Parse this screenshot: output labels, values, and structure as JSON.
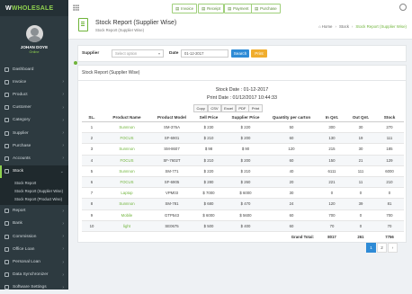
{
  "app": {
    "logo_prefix": "W",
    "logo_text": "WHOLESALE"
  },
  "user": {
    "name": "JOHAN DOYE",
    "status": "Online"
  },
  "sidebar": {
    "items": [
      {
        "label": "Dashboard",
        "icon": "dashboard-icon",
        "has_children": false
      },
      {
        "label": "Invoice",
        "icon": "invoice-icon",
        "has_children": true
      },
      {
        "label": "Product",
        "icon": "product-icon",
        "has_children": true
      },
      {
        "label": "Customer",
        "icon": "customer-icon",
        "has_children": true
      },
      {
        "label": "Category",
        "icon": "category-icon",
        "has_children": true
      },
      {
        "label": "Supplier",
        "icon": "supplier-icon",
        "has_children": true
      },
      {
        "label": "Purchase",
        "icon": "purchase-icon",
        "has_children": true
      },
      {
        "label": "Accounts",
        "icon": "accounts-icon",
        "has_children": true
      },
      {
        "label": "Stock",
        "icon": "stock-icon",
        "has_children": true,
        "active": true
      }
    ],
    "stock_sub": [
      "Stock Report",
      "Stock Report (Supplier Wise)",
      "Stock Report (Product Wise)"
    ],
    "items_after": [
      {
        "label": "Report",
        "icon": "report-icon",
        "has_children": true
      },
      {
        "label": "Bank",
        "icon": "bank-icon",
        "has_children": true
      },
      {
        "label": "Commission",
        "icon": "commission-icon",
        "has_children": true
      },
      {
        "label": "Office Loan",
        "icon": "office-loan-icon",
        "has_children": true
      },
      {
        "label": "Personal Loan",
        "icon": "personal-loan-icon",
        "has_children": true
      },
      {
        "label": "Data Synchronizer",
        "icon": "sync-icon",
        "has_children": true
      },
      {
        "label": "Software Settings",
        "icon": "settings-icon",
        "has_children": true
      }
    ]
  },
  "topbar": {
    "invoice": "Invoice",
    "receipt": "Receipt",
    "payment": "Payment",
    "purchase": "Purchase"
  },
  "header": {
    "title": "Stock Report (Supplier Wise)",
    "subtitle": "Stock Report (Supplier Wise)"
  },
  "breadcrumb": {
    "home": "Home",
    "stock": "Stock",
    "current": "Stock Report (Supplier Wise)"
  },
  "filter": {
    "supplier_label": "Supplier",
    "supplier_placeholder": "Select option",
    "date_label": "Date",
    "date_value": "01-12-2017",
    "search_btn": "Search",
    "print_btn": "Print"
  },
  "card": {
    "title": "Stock Report (Supplier Wise)",
    "stock_date": "Stock Date : 01-12-2017",
    "print_date": "Print Date : 01/12/2017 10:44:33"
  },
  "exports": [
    "Copy",
    "CSV",
    "Excel",
    "PDF",
    "Print"
  ],
  "table": {
    "headers": [
      "SL.",
      "Product Name",
      "Product Model",
      "Sell Price",
      "Supplier Price",
      "Quantity per carton",
      "In Qnt.",
      "Out Qnt.",
      "Stock"
    ],
    "rows": [
      [
        "1",
        "Sunnnon",
        "SM-376A",
        "$ 230",
        "$ 220",
        "50",
        "300",
        "30",
        "270"
      ],
      [
        "2",
        "FOCUS",
        "SF-6901",
        "$ 210",
        "$ 200",
        "60",
        "130",
        "19",
        "111"
      ],
      [
        "3",
        "Sunnnon",
        "SM-8607",
        "$ 98",
        "$ 90",
        "120",
        "215",
        "30",
        "185"
      ],
      [
        "4",
        "FOCUS",
        "SF-7602T",
        "$ 210",
        "$ 200",
        "60",
        "150",
        "21",
        "129"
      ],
      [
        "5",
        "Sunnnon",
        "SM-771",
        "$ 220",
        "$ 210",
        "40",
        "6111",
        "111",
        "6000"
      ],
      [
        "6",
        "FOCUS",
        "SF-6905",
        "$ 280",
        "$ 260",
        "20",
        "221",
        "11",
        "210"
      ],
      [
        "7",
        "Laptop",
        "VPM03",
        "$ 7000",
        "$ 6000",
        "30",
        "0",
        "0",
        "0"
      ],
      [
        "8",
        "Sunnnon",
        "SM-781",
        "$ 680",
        "$ 470",
        "24",
        "120",
        "39",
        "81"
      ],
      [
        "9",
        "Mobile",
        "GTP543",
        "$ 6000",
        "$ 5600",
        "60",
        "700",
        "0",
        "700"
      ],
      [
        "10",
        "light",
        "SE0675",
        "$ 500",
        "$ 400",
        "60",
        "70",
        "0",
        "70"
      ]
    ],
    "total_label": "Grand Total:",
    "total_in": "8017",
    "total_out": "261",
    "total_stock": "7756"
  },
  "pagination": {
    "pages": [
      "1",
      "2"
    ],
    "next": "›",
    "active": 0
  },
  "colors": {
    "sidebar": "#2d3a40",
    "accent": "#6fb43a",
    "primary": "#2e8bd6",
    "warning": "#f0ad2e"
  }
}
